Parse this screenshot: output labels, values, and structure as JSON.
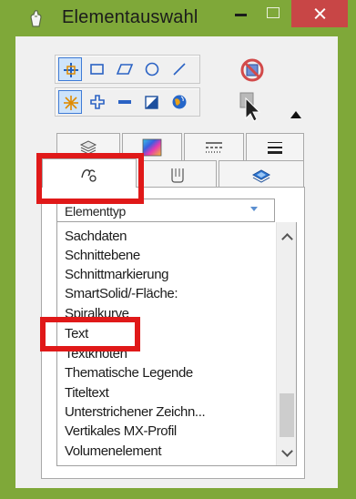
{
  "window": {
    "title": "Elementauswahl",
    "colors": {
      "frame": "#7fa839",
      "close": "#c84646",
      "highlight": "#e01919",
      "accent": "#3e7bd6"
    }
  },
  "toolbar": {
    "row1_tools": [
      "element-select-icon",
      "rectangle-icon",
      "parallelogram-icon",
      "circle-icon",
      "line-icon"
    ],
    "row2_tools": [
      "all-select-icon",
      "add-icon",
      "subtract-icon",
      "invert-icon",
      "globe-icon"
    ],
    "right_tools": [
      "clear-selection-icon",
      "pointer-icon",
      "collapse-arrow-icon"
    ]
  },
  "tabs": {
    "row1": [
      "layers-icon",
      "color-icon",
      "line-style-icon",
      "line-weight-icon"
    ],
    "row2": [
      "element-type-icon",
      "cell-icon",
      "view-icon"
    ],
    "selected": "element-type-icon"
  },
  "filter": {
    "combo_value": "Elementtyp",
    "items": [
      "Sachdaten",
      "Schnittebene",
      "Schnittmarkierung",
      "SmartSolid/-Fläche:",
      "Spiralkurve",
      "Text",
      "Textknoten",
      "Thematische Legende",
      "Titeltext",
      "Unterstrichener Zeichn...",
      "Vertikales MX-Profil",
      "Volumenelement"
    ]
  }
}
